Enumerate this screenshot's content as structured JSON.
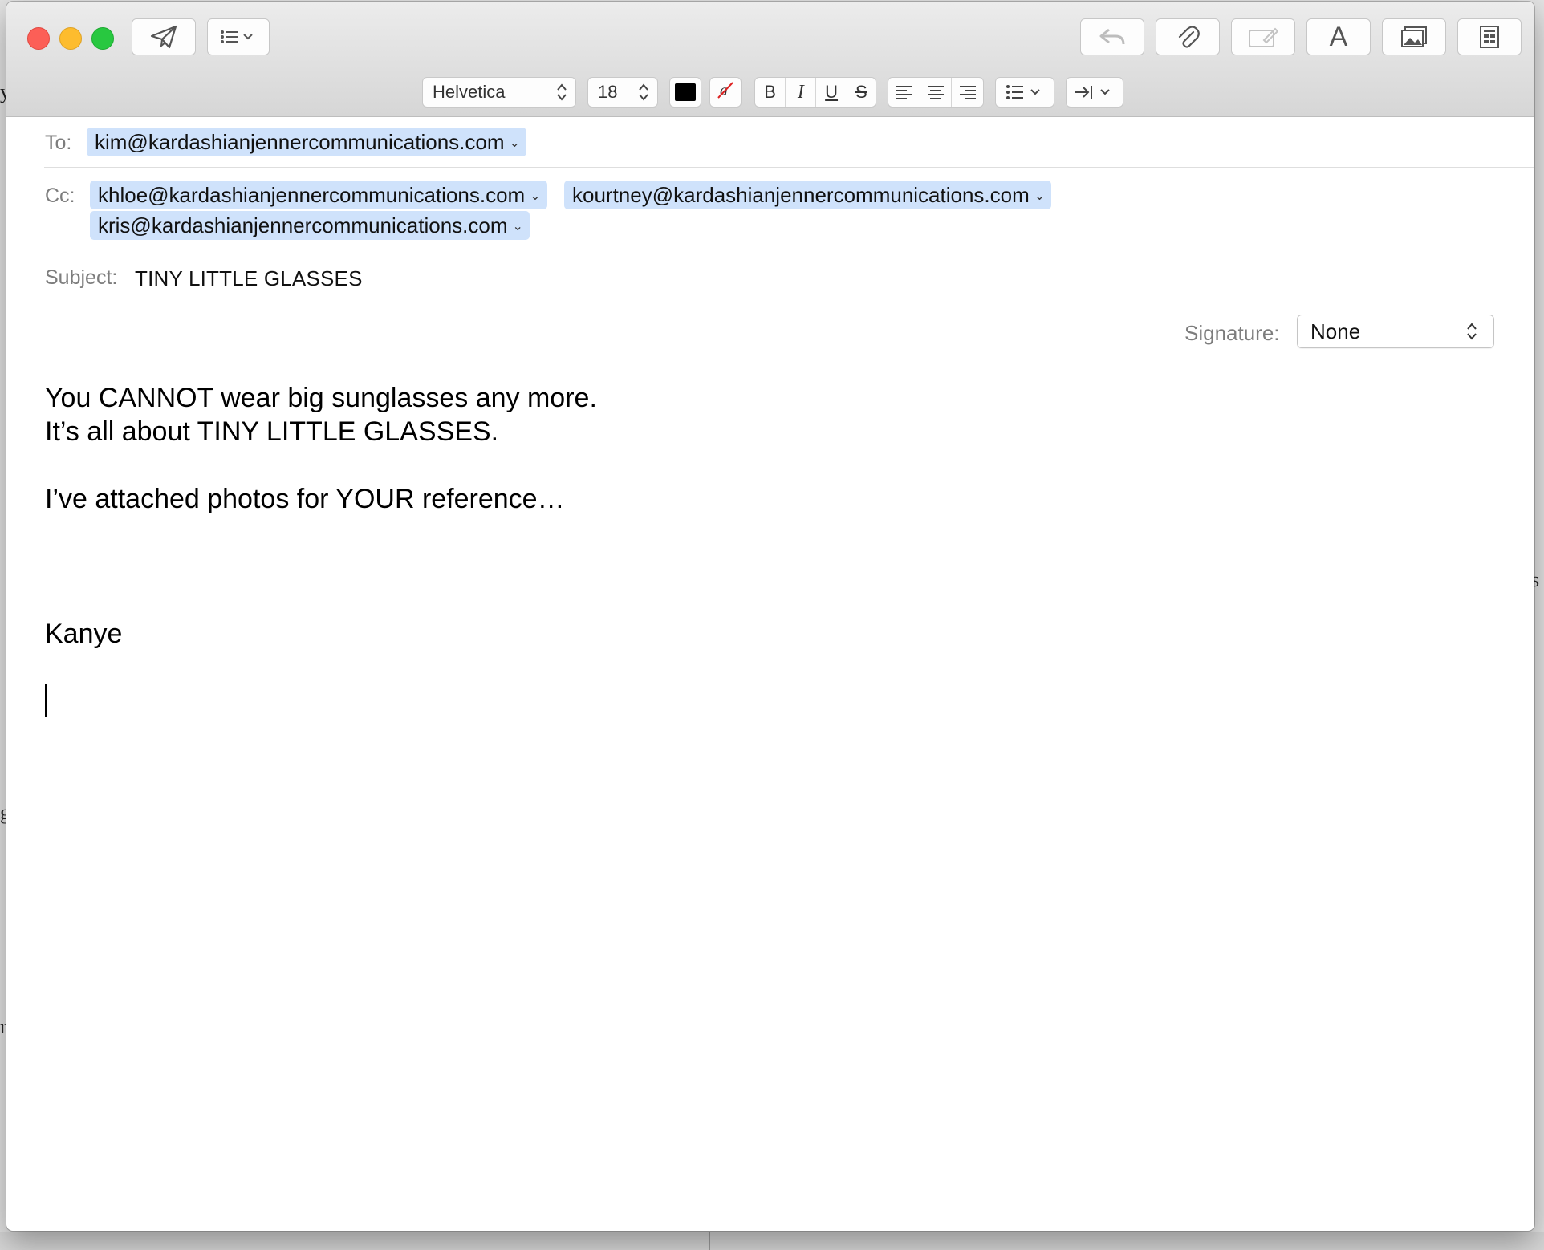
{
  "toolbar": {
    "send_icon": "paper-plane-icon",
    "header_fields_icon": "list-menu-icon",
    "reply_icon": "reply-arrow-icon",
    "attach_icon": "paperclip-icon",
    "markup_icon": "markup-icon",
    "fonts_label": "A",
    "photo_browser_icon": "photo-icon",
    "stationery_icon": "stationery-icon"
  },
  "format_bar": {
    "font_family": "Helvetica",
    "font_size": "18",
    "text_color": "#000000",
    "bold": "B",
    "italic": "I",
    "underline": "U",
    "strikethrough": "S",
    "alignment_icons": [
      "align-left-icon",
      "align-center-icon",
      "align-right-icon"
    ],
    "list_icon": "bulleted-list-icon",
    "indent_icon": "indent-icon"
  },
  "header": {
    "to_label": "To:",
    "to": [
      "kim@kardashianjennercommunications.com"
    ],
    "cc_label": "Cc:",
    "cc": [
      "khloe@kardashianjennercommunications.com",
      "kourtney@kardashianjennercommunications.com",
      "kris@kardashianjennercommunications.com"
    ],
    "subject_label": "Subject:",
    "subject": "TINY LITTLE GLASSES",
    "signature_label": "Signature:",
    "signature": "None"
  },
  "message": {
    "lines": [
      "You CANNOT wear big sunglasses any more.",
      "It’s all about TINY LITTLE GLASSES.",
      "I’ve attached photos for YOUR reference…",
      "Kanye"
    ]
  },
  "background": {
    "fragments": [
      "y",
      "s",
      "g",
      "r"
    ]
  },
  "colors": {
    "token_bg": "#cfe2fb",
    "close": "#fc5f57",
    "minimize": "#fdbc2e",
    "maximize": "#28c840"
  }
}
